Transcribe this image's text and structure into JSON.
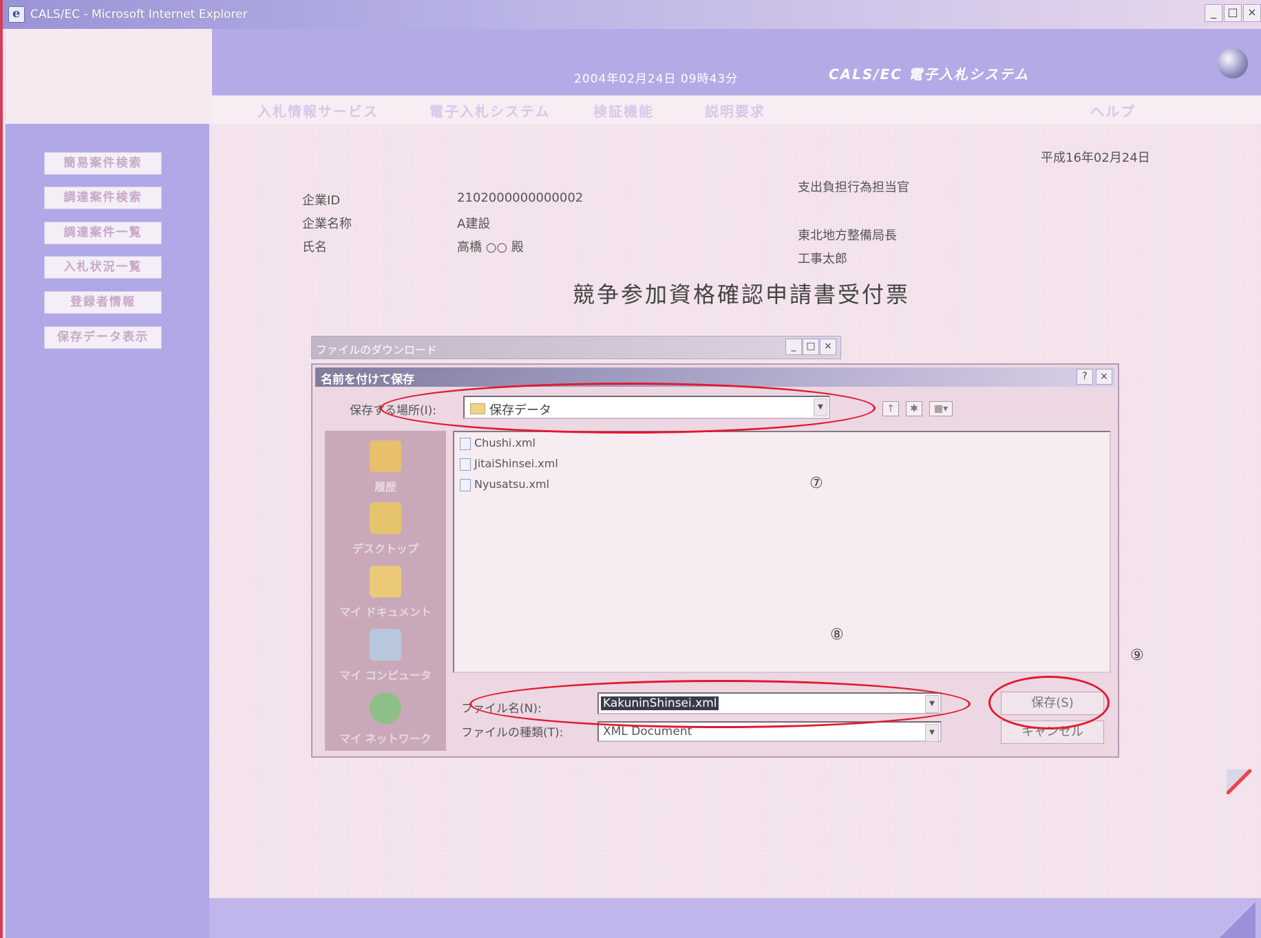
{
  "window": {
    "title": "CALS/EC - Microsoft Internet Explorer",
    "controls": [
      "_",
      "□",
      "×"
    ]
  },
  "header": {
    "datetime": "2004年02月24日 09時43分",
    "system_name": "CALS/EC 電子入札システム",
    "nav": [
      "入札情報サービス",
      "電子入札システム",
      "検証機能",
      "説明要求",
      "ヘルプ"
    ]
  },
  "sidebar": {
    "items": [
      "簡易案件検索",
      "調達案件検索",
      "調達案件一覧",
      "入札状況一覧",
      "登録者情報",
      "保存データ表示"
    ]
  },
  "document": {
    "date": "平成16年02月24日",
    "company_id_label": "企業ID",
    "company_id_value": "2102000000000002",
    "company_name_label": "企業名称",
    "company_name_value": "A建設",
    "person_label": "氏名",
    "person_value": "高橋 ○○ 殿",
    "recipient_line1": "支出負担行為担当官",
    "recipient_line2": "東北地方整備局長",
    "recipient_line3": "工事太郎",
    "title": "競争参加資格確認申請書受付票"
  },
  "download_dialog": {
    "title": "ファイルのダウンロード",
    "controls": [
      "_",
      "□",
      "×"
    ]
  },
  "save_dialog": {
    "title": "名前を付けて保存",
    "controls": [
      "?",
      "×"
    ],
    "location_label": "保存する場所(I):",
    "location_value": "保存データ",
    "places": [
      "履歴",
      "デスクトップ",
      "マイ ドキュメント",
      "マイ コンピュータ",
      "マイ ネットワーク"
    ],
    "files": [
      "Chushi.xml",
      "JitaiShinsei.xml",
      "Nyusatsu.xml"
    ],
    "filename_label": "ファイル名(N):",
    "filename_value": "KakuninShinsei.xml",
    "filetype_label": "ファイルの種類(T):",
    "filetype_value": "XML Document",
    "save_button": "保存(S)",
    "cancel_button": "キャンセル"
  },
  "annotations": {
    "marker_7": "⑦",
    "marker_8": "⑧",
    "marker_9": "⑨",
    "highlight_color": "#e2192d"
  }
}
